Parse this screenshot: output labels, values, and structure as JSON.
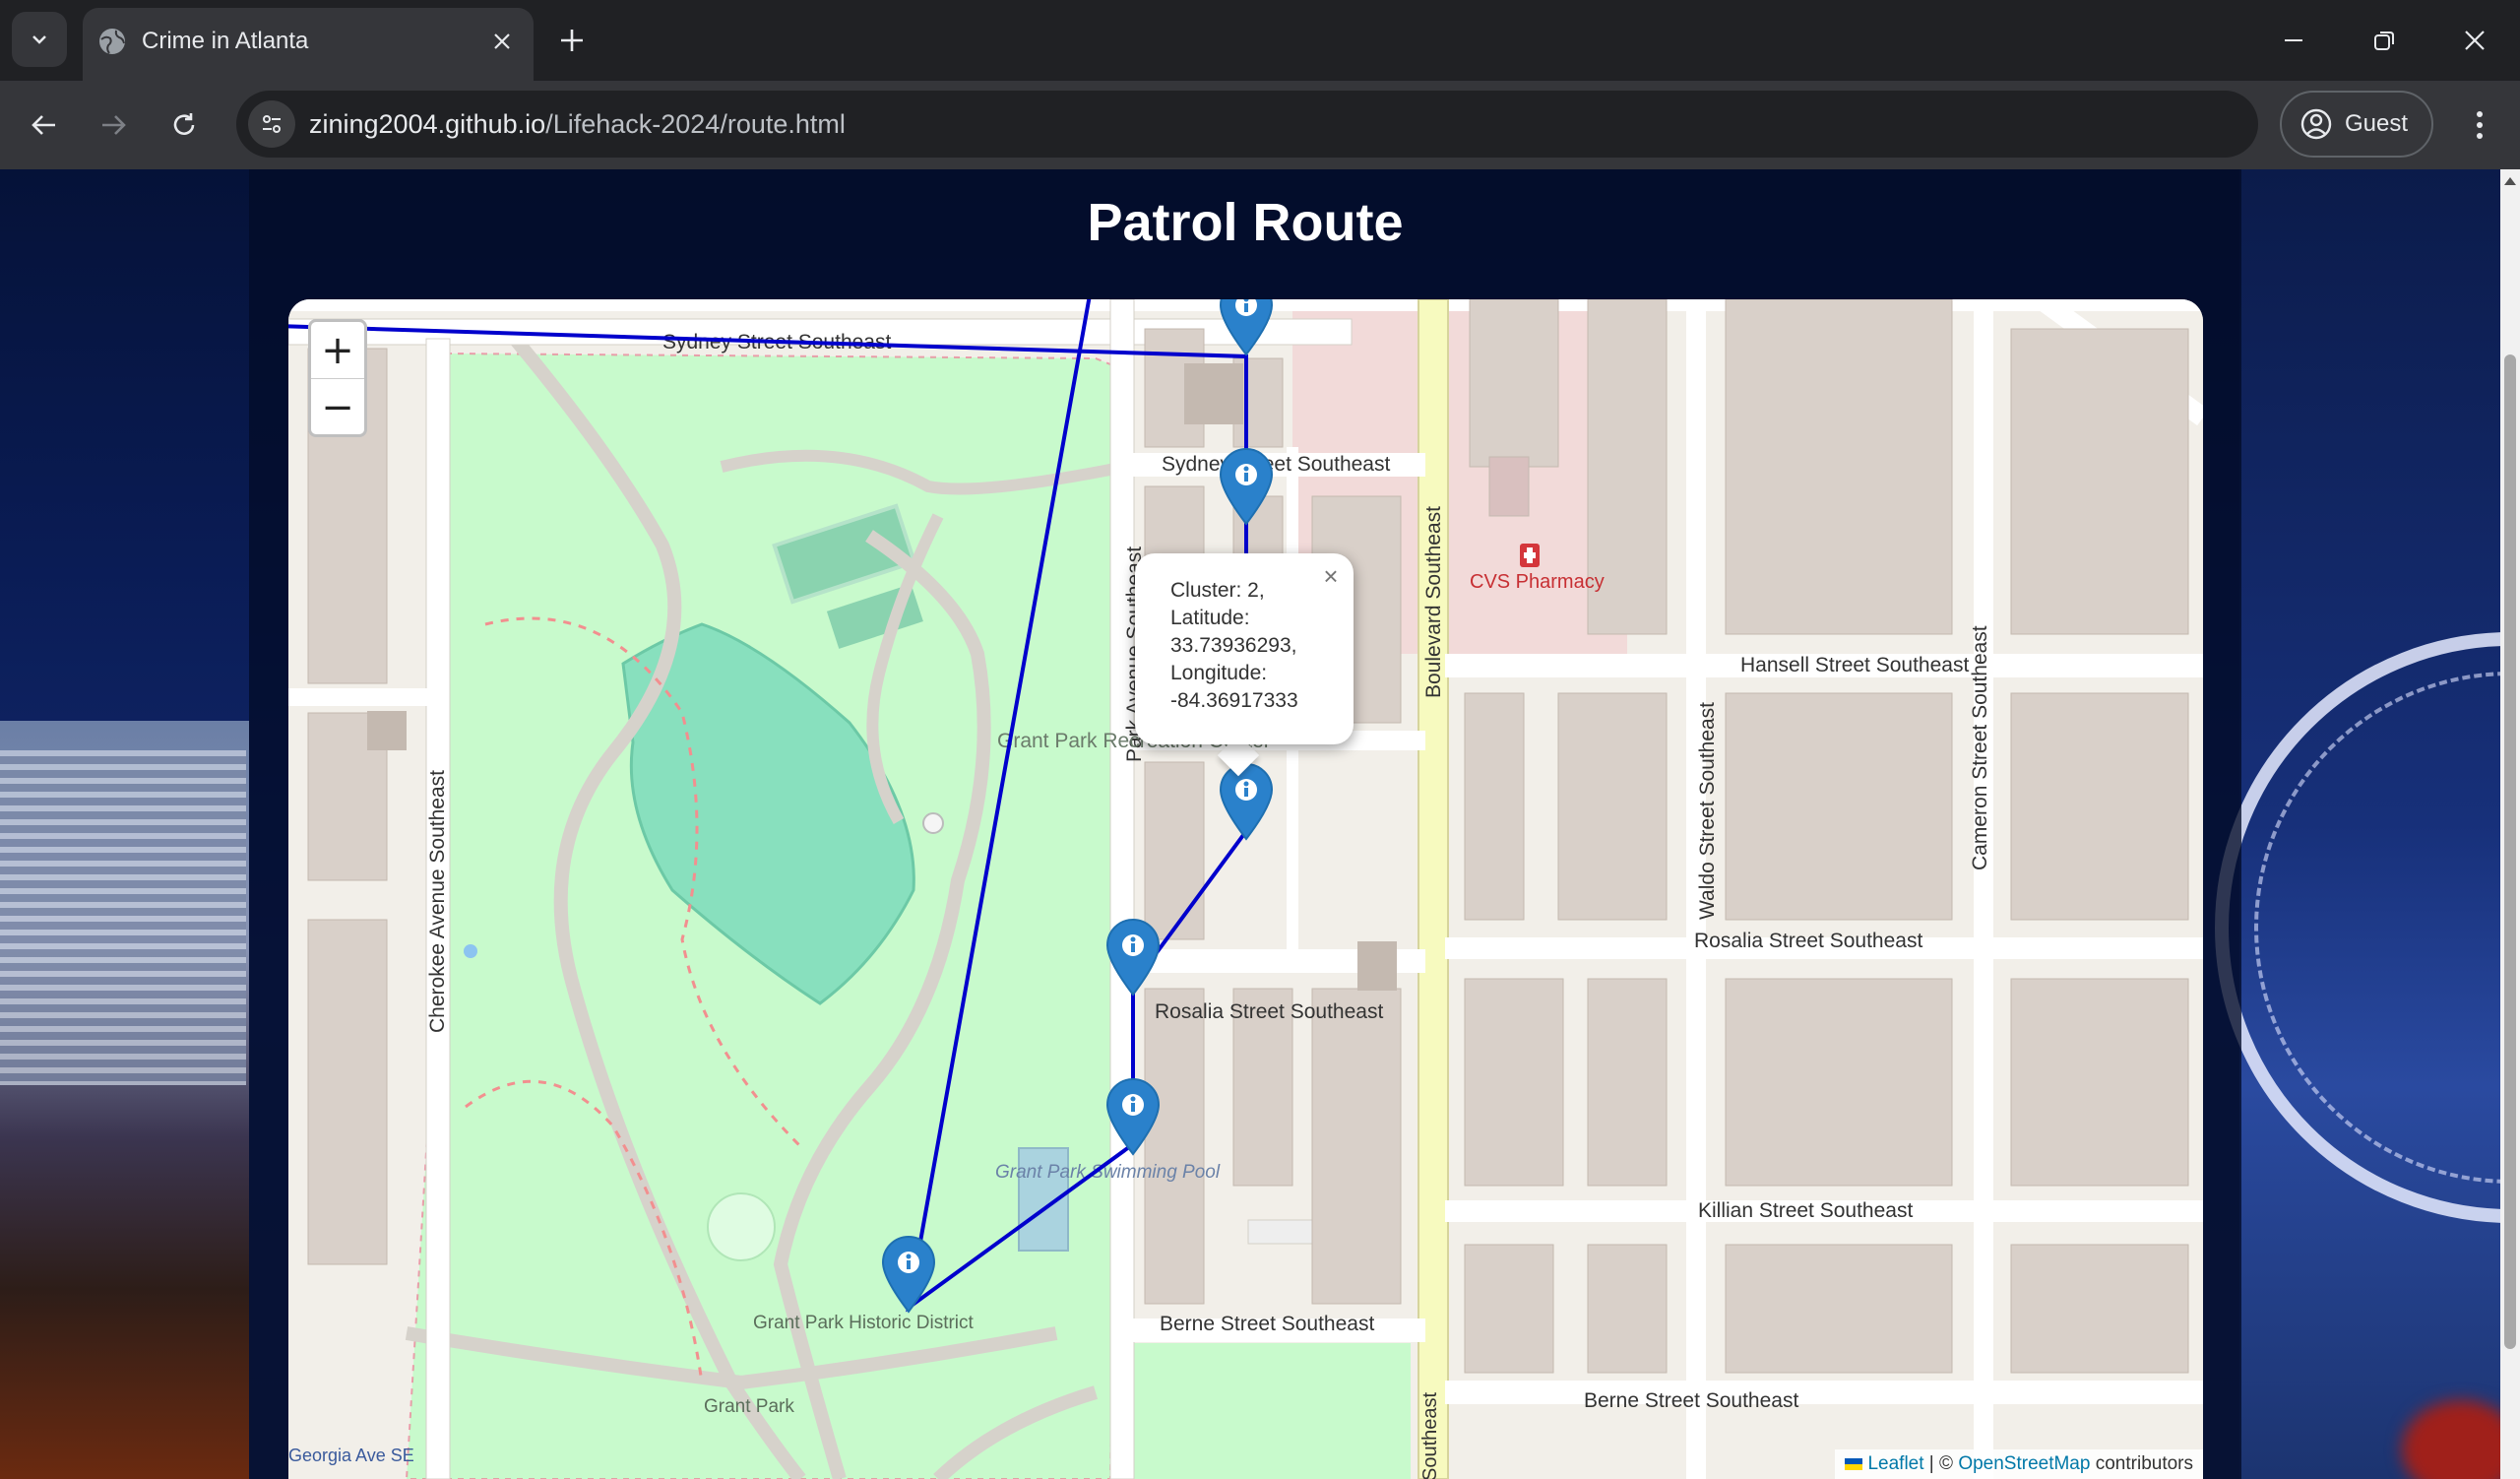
{
  "browser": {
    "tab_title": "Crime in Atlanta",
    "url_host": "zining2004.github.io",
    "url_path": "/Lifehack-2024/route.html",
    "profile_label": "Guest"
  },
  "page": {
    "title": "Patrol Route"
  },
  "map": {
    "zoom_in_label": "+",
    "zoom_out_label": "−",
    "attribution": {
      "leaflet": "Leaflet",
      "separator": " | © ",
      "osm": "OpenStreetMap",
      "suffix": " contributors"
    },
    "popup": {
      "line1": "Cluster: 2,",
      "line2": "Latitude:",
      "line3": "33.73936293,",
      "line4": "Longitude:",
      "line5": "-84.36917333",
      "close": "×"
    },
    "streets": [
      "Sydney Street Southeast",
      "Sydney Street Southeast",
      "Boulevard Southeast",
      "Park Avenue Southeast",
      "Cherokee Avenue Southeast",
      "Hansell Street Southeast",
      "Rosalia Street Southeast",
      "Rosalia Street Southeast",
      "Killian Street Southeast",
      "Berne Street Southeast",
      "Berne Street Southeast",
      "Waldo Street Southeast",
      "Cameron Street Southeast",
      "Southeast"
    ],
    "places": [
      "CVS Pharmacy",
      "Grant Park Recreation Center",
      "Grant Park Swimming Pool",
      "Grant Park Historic District",
      "Grant Park",
      "Georgia Ave SE"
    ],
    "route_color": "#0000cc",
    "marker_color": "#2a81cb"
  }
}
